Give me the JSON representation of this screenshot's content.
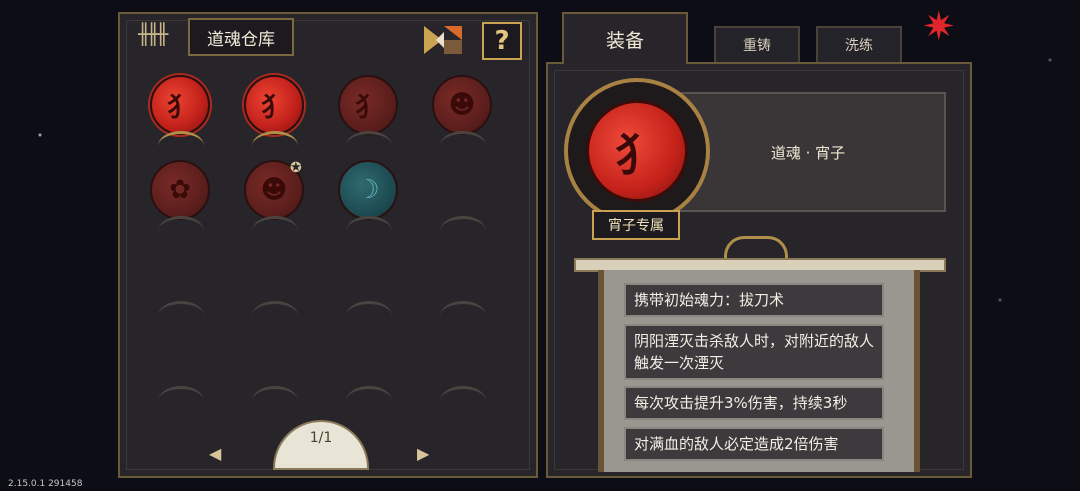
{
  "left": {
    "title": "道魂仓库",
    "help_label": "?",
    "pager": {
      "page": "1/1",
      "prev_icon": "◀",
      "next_icon": "▶"
    },
    "star_icon": "✪",
    "orbs": [
      {
        "state": "bright",
        "glyph": "犭"
      },
      {
        "state": "bright",
        "glyph": "犭"
      },
      {
        "state": "dim",
        "glyph": "犭"
      },
      {
        "state": "dim",
        "glyph": "☻"
      },
      {
        "state": "dim",
        "glyph": "✿"
      },
      {
        "state": "dim",
        "glyph": "☻"
      },
      {
        "state": "teal",
        "glyph": "☽"
      },
      {
        "state": "empty",
        "glyph": ""
      },
      {
        "state": "empty",
        "glyph": ""
      },
      {
        "state": "empty",
        "glyph": ""
      },
      {
        "state": "empty",
        "glyph": ""
      },
      {
        "state": "empty",
        "glyph": ""
      },
      {
        "state": "empty",
        "glyph": ""
      },
      {
        "state": "empty",
        "glyph": ""
      },
      {
        "state": "empty",
        "glyph": ""
      },
      {
        "state": "empty",
        "glyph": ""
      }
    ]
  },
  "right": {
    "tabs": {
      "equip": "装备",
      "reforge": "重铸",
      "refine": "洗练"
    },
    "soul_name": "道魂 · 宵子",
    "exclusive_label": "宵子专属",
    "big_orb_glyph": "犭",
    "effects": [
      "携带初始魂力：拔刀术",
      "阴阳湮灭击杀敌人时，对附近的敌人触发一次湮灭",
      "每次攻击提升3%伤害，持续3秒",
      "对满血的敌人必定造成2倍伤害"
    ]
  },
  "version": "2.15.0.1 291458",
  "colors": {
    "accent_gold": "#c9a352",
    "orb_red": "#c0201a",
    "panel": "#28252a"
  }
}
